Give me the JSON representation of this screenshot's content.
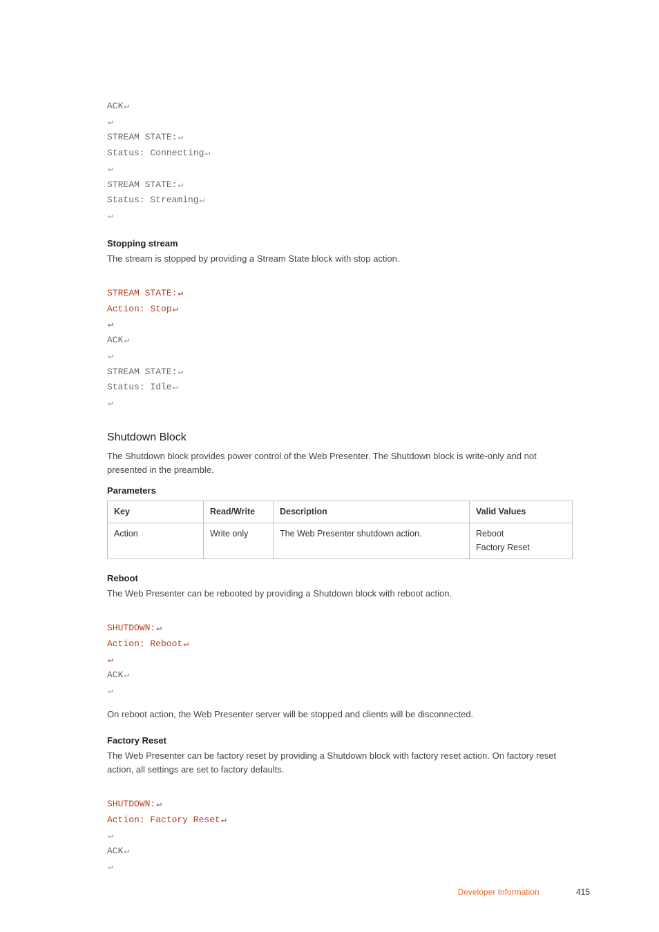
{
  "code1": {
    "l1": "ACK",
    "l2": "",
    "l3": "STREAM STATE:",
    "l4": "Status: Connecting",
    "l5": "",
    "l6": "STREAM STATE:",
    "l7": "Status: Streaming",
    "l8": ""
  },
  "stopping": {
    "heading": "Stopping stream",
    "para": "The stream is stopped by providing a Stream State block with stop action."
  },
  "code2": {
    "l1": "STREAM STATE:",
    "l2": "Action: Stop",
    "l3": "",
    "l4": "ACK",
    "l5": "",
    "l6": "STREAM STATE:",
    "l7": "Status: Idle",
    "l8": ""
  },
  "shutdown": {
    "heading": "Shutdown Block",
    "para": "The Shutdown block provides power control of the Web Presenter. The Shutdown block is write-only and not presented in the preamble.",
    "params_heading": "Parameters"
  },
  "table": {
    "h1": "Key",
    "h2": "Read/Write",
    "h3": "Description",
    "h4": "Valid Values",
    "r1c1": "Action",
    "r1c2": "Write only",
    "r1c3": "The Web Presenter shutdown action.",
    "r1c4a": "Reboot",
    "r1c4b": "Factory Reset"
  },
  "reboot": {
    "heading": "Reboot",
    "para": "The Web Presenter can be rebooted by providing a Shutdown block with reboot action."
  },
  "code3": {
    "l1": "SHUTDOWN:",
    "l2": "Action: Reboot",
    "l3": "",
    "l4": "ACK",
    "l5": ""
  },
  "reboot_note": "On reboot action, the Web Presenter server will be stopped and clients will be disconnected.",
  "factory": {
    "heading": "Factory Reset",
    "para": "The Web Presenter can be factory reset by providing a Shutdown block with factory reset action. On factory reset action, all settings are set to factory defaults."
  },
  "code4": {
    "l1": "SHUTDOWN:",
    "l2": "Action: Factory Reset",
    "l3": "",
    "l4": "ACK",
    "l5": ""
  },
  "footer": {
    "section": "Developer Information",
    "page": "415"
  }
}
